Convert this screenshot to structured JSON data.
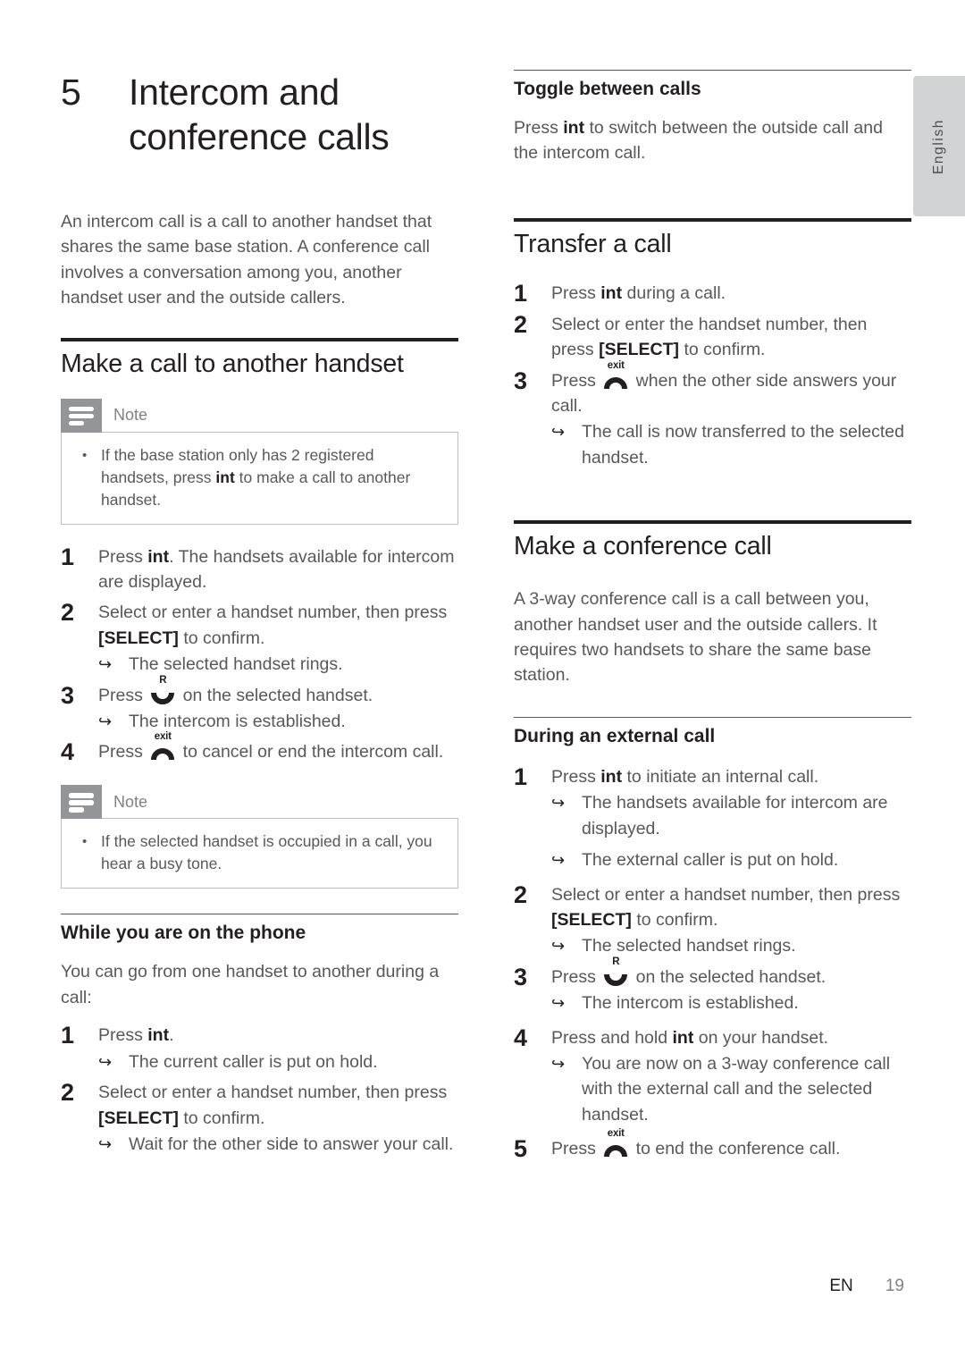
{
  "language_tab": {
    "label": "English"
  },
  "chapter": {
    "number": "5",
    "title": "Intercom and conference calls",
    "intro": "An intercom call is a call to another handset that shares the same base station. A conference call involves a conversation among you, another handset user and the outside callers."
  },
  "icons": {
    "talk": {
      "name": "talk-key-icon",
      "label": "R"
    },
    "exit": {
      "name": "exit-key-icon",
      "label": "exit"
    },
    "note": {
      "name": "note-icon"
    }
  },
  "left_column": {
    "section_make_call": {
      "heading": "Make a call to another handset",
      "note": {
        "title": "Note",
        "items": [
          "If the base station only has 2 registered handsets, press int to make a call to another handset."
        ],
        "item1_pre": "If the base station only has 2 registered handsets, press ",
        "item1_key": "int",
        "item1_post": " to make a call to another handset."
      },
      "steps": [
        {
          "num": "1",
          "pre": "Press ",
          "key": "int",
          "post": ". The handsets available for intercom are displayed."
        },
        {
          "num": "2",
          "pre": "Select or enter a handset number, then press ",
          "key": "[SELECT]",
          "post": " to confirm.",
          "results": [
            "The selected handset rings."
          ]
        },
        {
          "num": "3",
          "pre": "Press ",
          "icon": "talk",
          "post": " on the selected handset.",
          "results": [
            "The intercom is established."
          ]
        },
        {
          "num": "4",
          "pre": "Press ",
          "icon": "exit",
          "post": " to cancel or end the intercom call."
        }
      ],
      "note2": {
        "title": "Note",
        "items": [
          "If the selected handset is occupied in a call, you hear a busy tone."
        ]
      }
    },
    "section_while_phone": {
      "heading": "While you are on the phone",
      "intro": "You can go from one handset to another during a call:",
      "steps": [
        {
          "num": "1",
          "pre": "Press ",
          "key": "int",
          "post": ".",
          "results": [
            "The current caller is put on hold."
          ]
        },
        {
          "num": "2",
          "pre": "Select or enter a handset number, then press ",
          "key": "[SELECT]",
          "post": " to confirm.",
          "results": [
            "Wait for the other side to answer your call."
          ]
        }
      ]
    }
  },
  "right_column": {
    "section_toggle": {
      "heading": "Toggle between calls",
      "para_pre": "Press ",
      "para_key": "int",
      "para_post": " to switch between the outside call and the intercom call."
    },
    "section_transfer": {
      "heading": "Transfer a call",
      "steps": [
        {
          "num": "1",
          "pre": "Press ",
          "key": "int",
          "post": " during a call."
        },
        {
          "num": "2",
          "pre": "Select or enter the handset number, then press ",
          "key": "[SELECT]",
          "post": " to confirm."
        },
        {
          "num": "3",
          "pre": "Press ",
          "icon": "exit",
          "post": " when the other side answers your call.",
          "results": [
            "The call is now transferred to the selected handset."
          ]
        }
      ]
    },
    "section_conference": {
      "heading": "Make a conference call",
      "intro": "A 3-way conference call is a call between you, another handset user and the outside callers. It requires two handsets to share the same base station.",
      "subsection": {
        "heading": "During an external call",
        "steps": [
          {
            "num": "1",
            "pre": "Press ",
            "key": "int",
            "post": " to initiate an internal call.",
            "results": [
              "The handsets available for intercom are displayed.",
              "The external caller is put on hold."
            ]
          },
          {
            "num": "2",
            "pre": "Select or enter a handset number, then press ",
            "key": "[SELECT]",
            "post": " to confirm.",
            "results": [
              "The selected handset rings."
            ]
          },
          {
            "num": "3",
            "pre": "Press ",
            "icon": "talk",
            "post": " on the selected handset.",
            "results": [
              "The intercom is established."
            ]
          },
          {
            "num": "4",
            "pre": "Press and hold ",
            "key": "int",
            "post": " on your handset.",
            "results": [
              "You are now on a 3-way conference call with the external call and the selected handset."
            ]
          },
          {
            "num": "5",
            "pre": "Press ",
            "icon": "exit",
            "post": " to end the conference call."
          }
        ]
      }
    }
  },
  "footer": {
    "language_code": "EN",
    "page_number": "19"
  }
}
